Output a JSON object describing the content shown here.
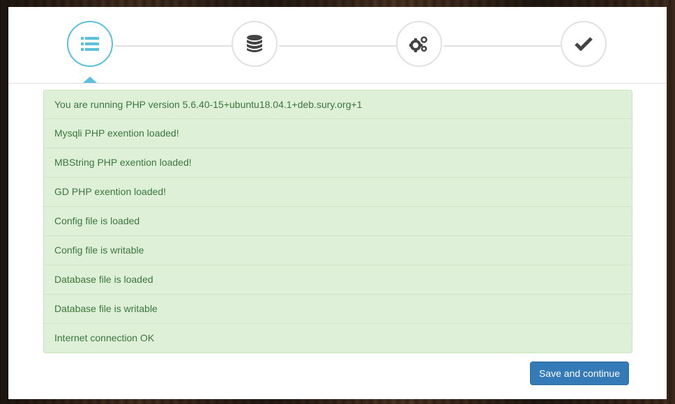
{
  "wizard": {
    "steps": [
      {
        "icon": "list-icon",
        "state": "active"
      },
      {
        "icon": "database-icon",
        "state": "pending"
      },
      {
        "icon": "gears-icon",
        "state": "pending"
      },
      {
        "icon": "checkmark-icon",
        "state": "pending"
      }
    ],
    "colors": {
      "active": "#5bc0de",
      "success_bg": "#dff0d8",
      "success_text": "#3c763d",
      "primary": "#337ab7"
    }
  },
  "checks": [
    "You are running PHP version 5.6.40-15+ubuntu18.04.1+deb.sury.org+1",
    "Mysqli PHP exention loaded!",
    "MBString PHP exention loaded!",
    "GD PHP exention loaded!",
    "Config file is loaded",
    "Config file is writable",
    "Database file is loaded",
    "Database file is writable",
    "Internet connection OK"
  ],
  "actions": {
    "save_label": "Save and continue"
  }
}
